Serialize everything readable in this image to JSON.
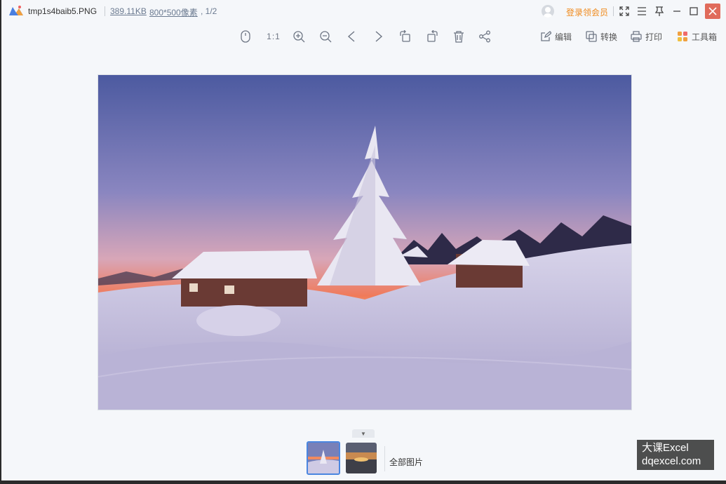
{
  "title_bar": {
    "file_name": "tmp1s4baib5.PNG",
    "file_size": "389.11KB",
    "dimensions": "800*500像素",
    "page_indicator": ", 1/2",
    "login_label": "登录领会员"
  },
  "toolbar": {
    "actual_size_label": "1:1",
    "edit_label": "编辑",
    "convert_label": "转换",
    "print_label": "打印",
    "toolbox_label": "工具箱"
  },
  "thumbnails": {
    "all_images_label": "全部图片",
    "items": [
      "winter-cabins",
      "sunset-sea"
    ]
  },
  "watermark": {
    "line1": "大课Excel",
    "line2": "dqexcel.com"
  },
  "colors": {
    "accent": "#4a86e0",
    "login_orange": "#f08a1c",
    "close_red": "#e06b5b",
    "background": "#f5f7fa"
  }
}
